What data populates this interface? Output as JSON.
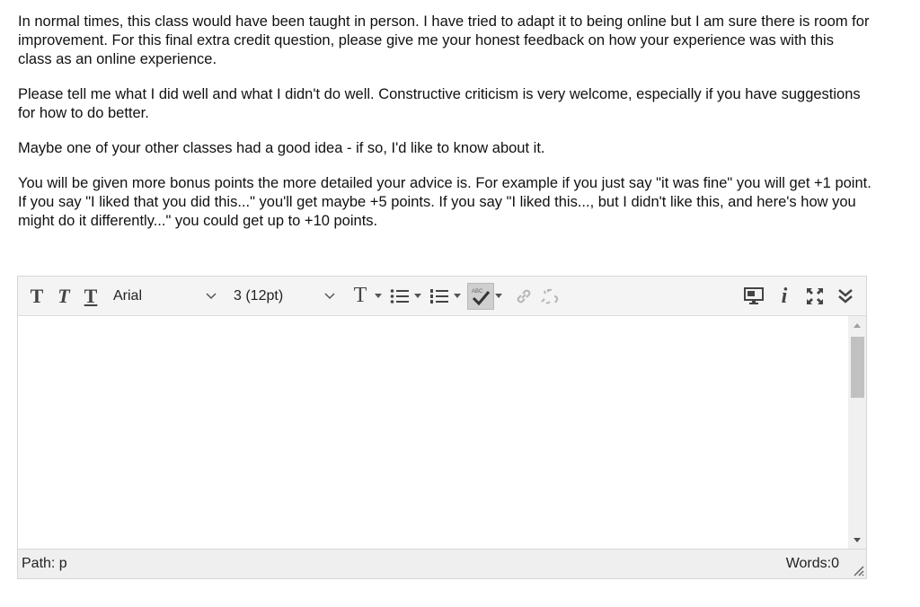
{
  "question": {
    "paragraphs": [
      "In normal times, this class would have been taught in person. I have tried to adapt it to being online but I am sure there is room for improvement. For this final extra credit question, please give me your honest feedback on how your experience was with this class as an online experience.",
      "Please tell me what I did well and what I didn't do well. Constructive criticism is very welcome, especially if you have suggestions for how to do better.",
      "Maybe one of your other classes had a good idea - if so, I'd like to know about it.",
      "You will be given more bonus points the more detailed your advice is. For example if you just say \"it was fine\" you will get +1 point. If you say \"I liked that you did this...\" you'll get maybe +5 points. If you say \"I liked this..., but I didn't like this, and here's how you might do it differently...\" you could get up to +10 points."
    ]
  },
  "editor": {
    "toolbar": {
      "bold_glyph": "T",
      "italic_glyph": "T",
      "underline_glyph": "T",
      "font_family": "Arial",
      "font_size": "3 (12pt)",
      "text_color_glyph": "T",
      "spellcheck_text": "ABC"
    },
    "content": "",
    "status": {
      "path_label": "Path: p",
      "word_count": "Words:0"
    }
  },
  "colors": {
    "toolbar_bg": "#f4f4f4",
    "icon_gray": "#444444",
    "disabled_icon": "#b5b5b5"
  }
}
